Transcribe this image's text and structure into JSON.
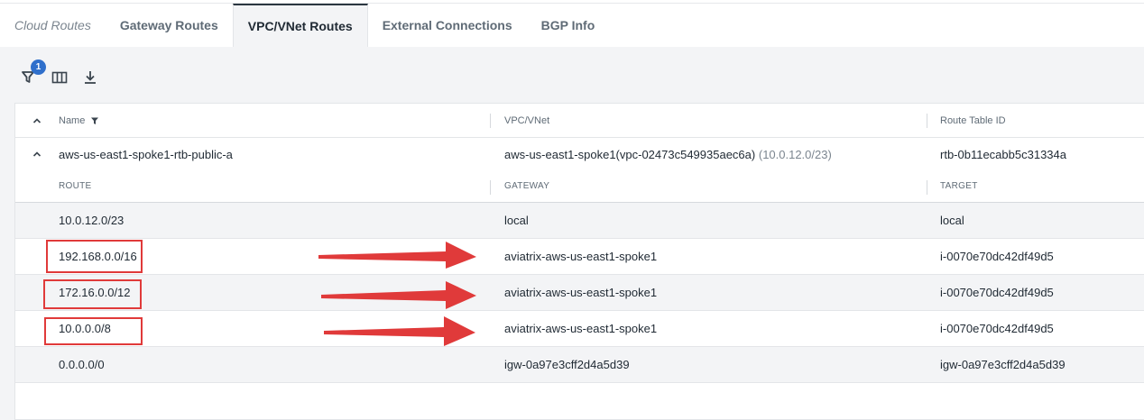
{
  "tabs": [
    {
      "label": "Cloud Routes"
    },
    {
      "label": "Gateway Routes"
    },
    {
      "label": "VPC/VNet Routes"
    },
    {
      "label": "External Connections"
    },
    {
      "label": "BGP Info"
    }
  ],
  "active_tab": "VPC/VNet Routes",
  "toolbar": {
    "filter_count": "1"
  },
  "table": {
    "columns": [
      "Name",
      "VPC/VNet",
      "Route Table ID"
    ],
    "group": {
      "name": "aws-us-east1-spoke1-rtb-public-a",
      "vpc": "aws-us-east1-spoke1(vpc-02473c549935aec6a)",
      "cidr": "(10.0.12.0/23)",
      "route_table_id": "rtb-0b11ecabb5c31334a"
    },
    "subcolumns": [
      "ROUTE",
      "GATEWAY",
      "TARGET"
    ],
    "routes": [
      {
        "route": "10.0.12.0/23",
        "gateway": "local",
        "target": "local"
      },
      {
        "route": "192.168.0.0/16",
        "gateway": "aviatrix-aws-us-east1-spoke1",
        "target": "i-0070e70dc42df49d5"
      },
      {
        "route": "172.16.0.0/12",
        "gateway": "aviatrix-aws-us-east1-spoke1",
        "target": "i-0070e70dc42df49d5"
      },
      {
        "route": "10.0.0.0/8",
        "gateway": "aviatrix-aws-us-east1-spoke1",
        "target": "i-0070e70dc42df49d5"
      },
      {
        "route": "0.0.0.0/0",
        "gateway": "igw-0a97e3cff2d4a5d39",
        "target": "igw-0a97e3cff2d4a5d39"
      }
    ]
  },
  "colors": {
    "annotation_red": "#e03a3a",
    "badge_blue": "#2f6fcb"
  }
}
